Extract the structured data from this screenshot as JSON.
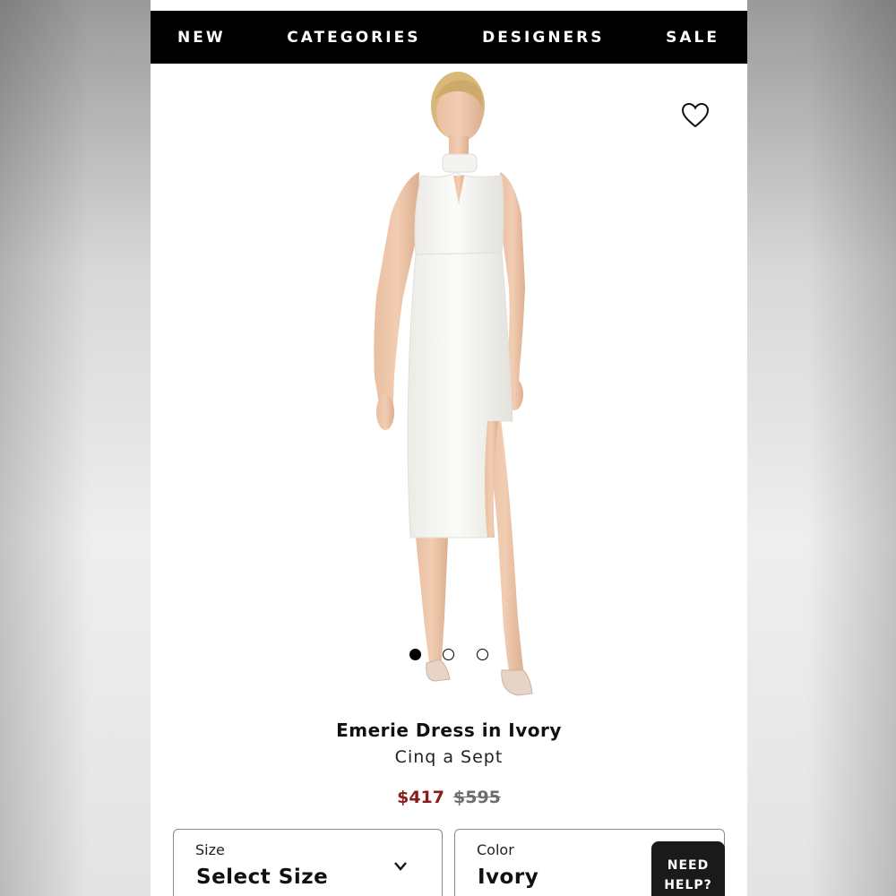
{
  "nav": {
    "items": [
      {
        "label": "NEW"
      },
      {
        "label": "CATEGORIES"
      },
      {
        "label": "DESIGNERS"
      },
      {
        "label": "SALE"
      }
    ]
  },
  "gallery": {
    "total_images": 3,
    "active_index": 0
  },
  "product": {
    "title": "Emerie Dress in Ivory",
    "brand": "Cinq a Sept",
    "sale_price": "$417",
    "original_price": "$595"
  },
  "size_selector": {
    "label": "Size",
    "value": "Select Size"
  },
  "color_selector": {
    "label": "Color",
    "value": "Ivory"
  },
  "help": {
    "line1": "NEED",
    "line2": "HELP?"
  },
  "colors": {
    "nav_bg": "#000000",
    "sale_price": "#8c1c1c",
    "original_price": "#6d6d6d"
  },
  "icons": [
    "heart-icon",
    "chevron-down-icon"
  ]
}
